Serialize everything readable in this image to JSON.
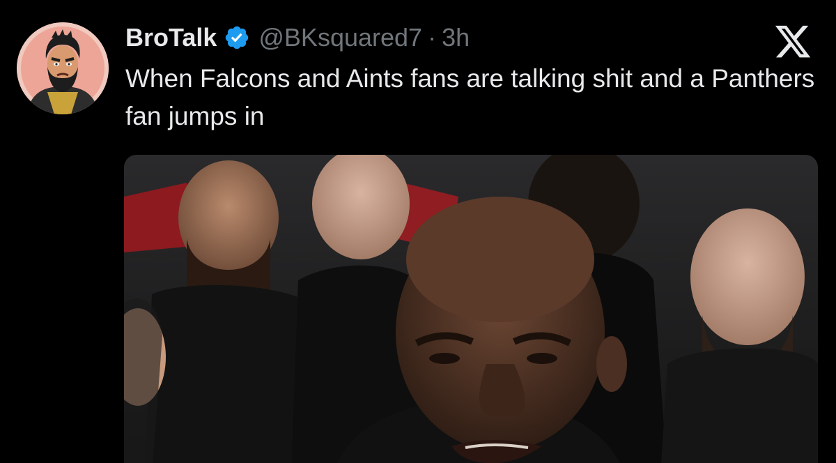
{
  "tweet": {
    "author": {
      "display_name": "BroTalk",
      "handle": "@BKsquared7",
      "verified": true,
      "verified_icon": "verified-badge-icon",
      "verified_color": "#1d9bf0"
    },
    "separator": "·",
    "time": "3h",
    "text": "When Falcons and Aints fans are talking shit and a Panthers fan jumps in",
    "platform_icon": "x-logo-icon",
    "media": {
      "type": "video-still",
      "subject": "reaction-face"
    }
  },
  "colors": {
    "background": "#000000",
    "primary_text": "#e7e9ea",
    "secondary_text": "#71767b",
    "accent": "#1d9bf0"
  }
}
